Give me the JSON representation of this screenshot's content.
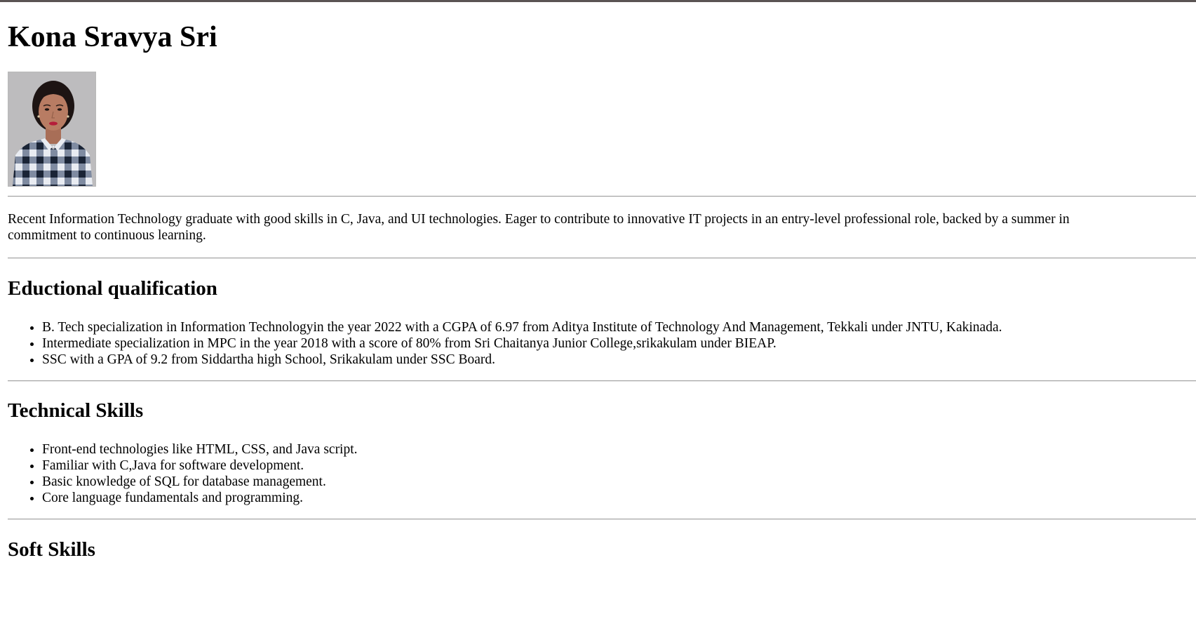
{
  "header": {
    "name": "Kona Sravya Sri"
  },
  "photo": {
    "alt": "Profile photo of Kona Sravya Sri",
    "colors": {
      "background": "#bdbcbe",
      "hair": "#1d1413",
      "skin": "#b87c63",
      "shirt_dark": "#1a2436",
      "shirt_light": "#e9ecf2",
      "lips": "#b51d3a"
    }
  },
  "summary": {
    "line1": "Recent Information Technology graduate with good skills in C, Java, and UI technologies. Eager to contribute to innovative IT projects in an entry-level professional role, backed by a summer in",
    "line2": "commitment to continuous learning."
  },
  "education": {
    "heading": "Eductional qualification",
    "items": [
      "B. Tech specialization in Information Technologyin the year 2022 with a CGPA of 6.97 from Aditya Institute of Technology And Management, Tekkali under JNTU, Kakinada.",
      "Intermediate specialization in MPC in the year 2018 with a score of 80% from Sri Chaitanya Junior College,srikakulam under BIEAP.",
      "SSC with a GPA of 9.2 from Siddartha high School, Srikakulam under SSC Board."
    ]
  },
  "technical": {
    "heading": "Technical Skills",
    "items": [
      "Front-end technologies like HTML, CSS, and Java script.",
      "Familiar with C,Java for software development.",
      "Basic knowledge of SQL for database management.",
      "Core language fundamentals and programming."
    ]
  },
  "soft": {
    "heading": "Soft Skills"
  }
}
